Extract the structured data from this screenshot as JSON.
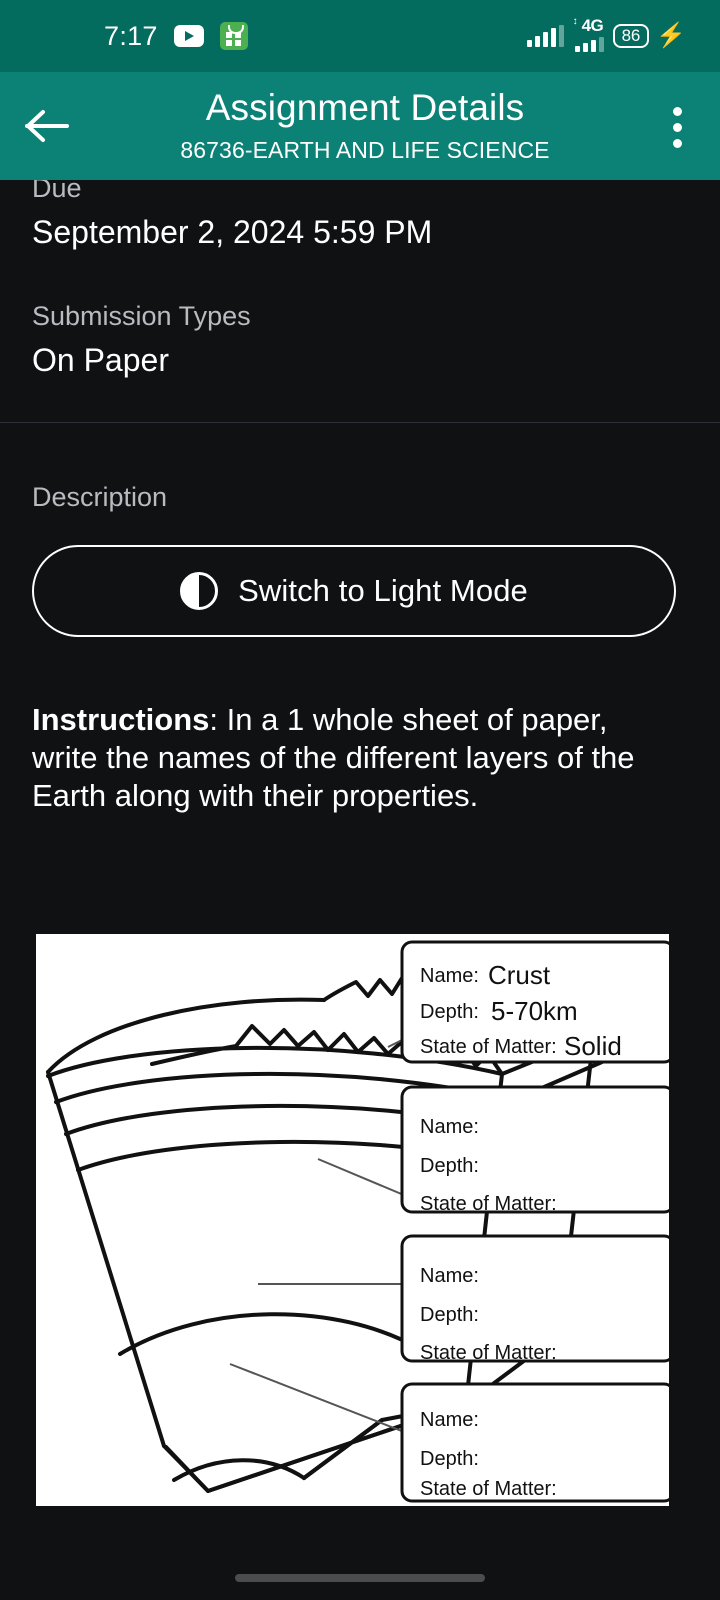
{
  "status_bar": {
    "time": "7:17",
    "battery_percent": "86",
    "network": "4G",
    "icons": [
      "youtube-icon",
      "shopping-app-icon",
      "signal-bars-icon",
      "mobile-data-icon",
      "battery-icon",
      "charging-bolt-icon"
    ]
  },
  "app_bar": {
    "title": "Assignment Details",
    "subtitle": "86736-EARTH AND LIFE SCIENCE",
    "back_icon": "back-arrow-icon",
    "overflow_icon": "overflow-menu-icon",
    "background_color": "#0B8275"
  },
  "details": {
    "due_label": "Due",
    "due_value": "September 2, 2024 5:59 PM",
    "submission_types_label": "Submission Types",
    "submission_types_value": "On Paper"
  },
  "description": {
    "label": "Description",
    "theme_toggle_label": "Switch to Light Mode",
    "theme_toggle_icon": "contrast-half-circle-icon",
    "instructions_prefix": "Instructions",
    "instructions_colon": ": ",
    "instructions_body": "In a 1 whole sheet of paper, write the names of the different layers of the Earth along with their properties."
  },
  "diagram": {
    "name": "earth-layers-worksheet-image",
    "alt": "Cutaway wedge of the Earth with four labeling boxes",
    "boxes": [
      {
        "name_label": "Name:",
        "name_value": "Crust",
        "depth_label": "Depth:",
        "depth_value": "5-70km",
        "state_label": "State of Matter:",
        "state_value": "Solid"
      },
      {
        "name_label": "Name:",
        "name_value": "",
        "depth_label": "Depth:",
        "depth_value": "",
        "state_label": "State of Matter:",
        "state_value": ""
      },
      {
        "name_label": "Name:",
        "name_value": "",
        "depth_label": "Depth:",
        "depth_value": "",
        "state_label": "State of Matter:",
        "state_value": ""
      },
      {
        "name_label": "Name:",
        "name_value": "",
        "depth_label": "Depth:",
        "depth_value": "",
        "state_label": "State of Matter:",
        "state_value": ""
      }
    ]
  },
  "nav_bar": {
    "gesture_pill": "home-gesture-pill"
  },
  "colors": {
    "status_bar_bg": "#046C5F",
    "app_bar_bg": "#0B8275",
    "page_bg": "#101113",
    "text_primary": "#ffffff",
    "text_secondary": "#b8bcc0",
    "divider": "#2c3237"
  }
}
